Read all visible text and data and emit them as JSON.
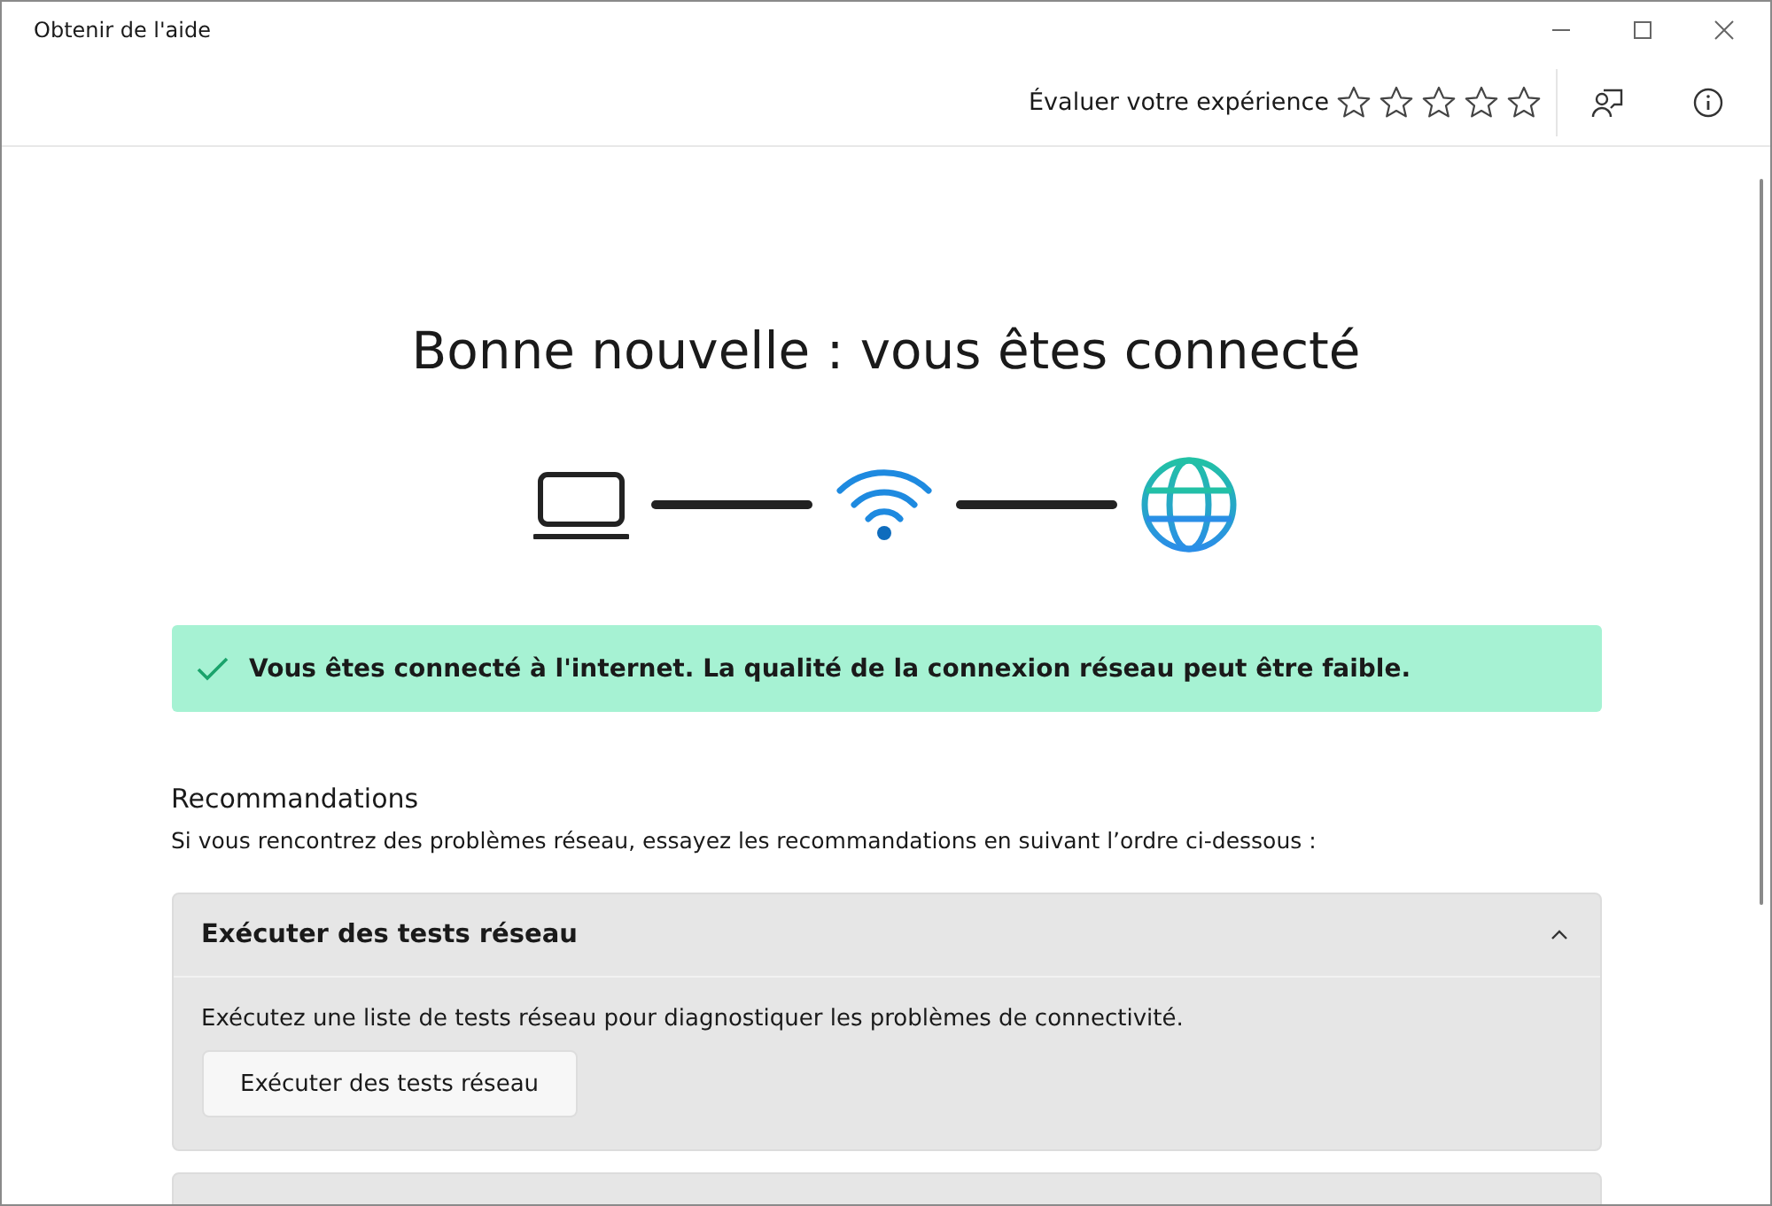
{
  "window": {
    "title": "Obtenir de l'aide"
  },
  "toolbar": {
    "rating_label": "Évaluer votre expérience",
    "stars": 0
  },
  "status": {
    "heading": "Bonne nouvelle : vous êtes connecté",
    "banner": "Vous êtes connecté à l'internet. La qualité de la connexion réseau peut être faible."
  },
  "recommendations": {
    "title": "Recommandations",
    "subtitle": "Si vous rencontrez des problèmes réseau, essayez les recommandations en suivant l’ordre ci-dessous :",
    "cards": [
      {
        "title": "Exécuter des tests réseau",
        "expanded": true,
        "description": "Exécutez une liste de tests réseau pour diagnostiquer les problèmes de connectivité.",
        "button": "Exécuter des tests réseau"
      },
      {
        "kind": "stub"
      }
    ]
  }
}
